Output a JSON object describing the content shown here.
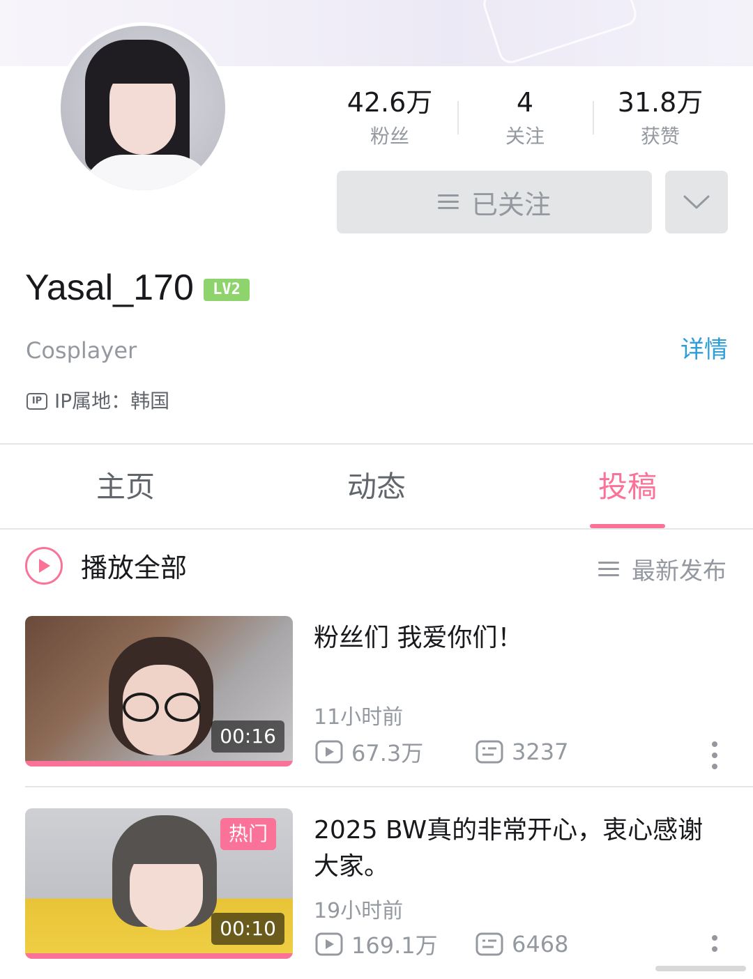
{
  "profile": {
    "username": "Yasal_170",
    "level_badge": "LV2",
    "bio": "Cosplayer",
    "detail_link": "详情",
    "ip_location": "IP属地：韩国",
    "ip_icon_text": "IP"
  },
  "stats": [
    {
      "value": "42.6万",
      "label": "粉丝"
    },
    {
      "value": "4",
      "label": "关注"
    },
    {
      "value": "31.8万",
      "label": "获赞"
    }
  ],
  "follow_button": {
    "label": "已关注",
    "icon": "menu-icon"
  },
  "dropdown_button": {
    "icon": "chevron-down-icon"
  },
  "tabs": [
    {
      "label": "主页",
      "active": false
    },
    {
      "label": "动态",
      "active": false
    },
    {
      "label": "投稿",
      "active": true
    }
  ],
  "list_header": {
    "play_all": "播放全部",
    "sort": "最新发布"
  },
  "videos": [
    {
      "title": "粉丝们 我爱你们！",
      "duration": "00:16",
      "time": "11小时前",
      "views": "67.3万",
      "danmaku": "3237",
      "hot": false
    },
    {
      "title": "2025 BW真的非常开心，衷心感谢大家。",
      "duration": "00:10",
      "time": "19小时前",
      "views": "169.1万",
      "danmaku": "6468",
      "hot": true,
      "hot_label": "热门"
    }
  ],
  "colors": {
    "accent": "#fb7299",
    "link": "#2d9fd8",
    "level": "#8ed36c",
    "text_secondary": "#9499a0"
  }
}
